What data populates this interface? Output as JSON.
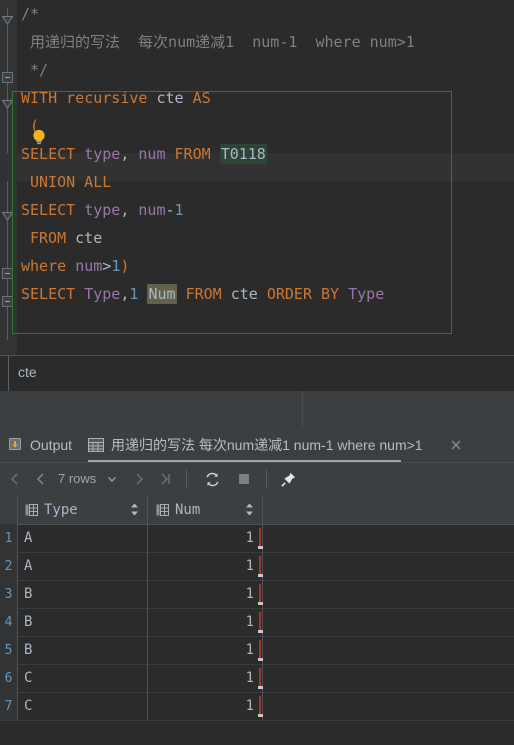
{
  "editor": {
    "lines": [
      {
        "indent": 0,
        "tokens": [
          {
            "t": "/*",
            "c": "cmt"
          }
        ]
      },
      {
        "indent": 1,
        "tokens": [
          {
            "t": "用递归的写法  每次num递减1  num-1  where num>1",
            "c": "cmt"
          }
        ]
      },
      {
        "indent": 1,
        "tokens": [
          {
            "t": "*/",
            "c": "cmt"
          }
        ]
      },
      {
        "indent": 0,
        "tokens": [
          {
            "t": "WITH",
            "c": "kw"
          },
          {
            "t": " ",
            "c": "punc"
          },
          {
            "t": "recursive",
            "c": "kw"
          },
          {
            "t": " ",
            "c": "punc"
          },
          {
            "t": "cte",
            "c": "id"
          },
          {
            "t": " ",
            "c": "punc"
          },
          {
            "t": "AS",
            "c": "kw"
          }
        ]
      },
      {
        "indent": 1,
        "tokens": [
          {
            "t": "(",
            "c": "kw"
          }
        ]
      },
      {
        "indent": 0,
        "tokens": [
          {
            "t": "SELECT",
            "c": "kw"
          },
          {
            "t": " ",
            "c": "punc"
          },
          {
            "t": "type",
            "c": "col"
          },
          {
            "t": ",",
            "c": "punc"
          },
          {
            "t": " ",
            "c": "punc"
          },
          {
            "t": "num",
            "c": "col"
          },
          {
            "t": " ",
            "c": "punc"
          },
          {
            "t": "FROM",
            "c": "kw"
          },
          {
            "t": " ",
            "c": "punc"
          },
          {
            "t": "T0118",
            "c": "id",
            "hl": "green"
          }
        ]
      },
      {
        "indent": 1,
        "tokens": [
          {
            "t": "UNION ALL",
            "c": "kw"
          }
        ]
      },
      {
        "indent": 0,
        "tokens": [
          {
            "t": "SELECT",
            "c": "kw"
          },
          {
            "t": " ",
            "c": "punc"
          },
          {
            "t": "type",
            "c": "col"
          },
          {
            "t": ",",
            "c": "punc"
          },
          {
            "t": " ",
            "c": "punc"
          },
          {
            "t": "num",
            "c": "col"
          },
          {
            "t": "-",
            "c": "punc"
          },
          {
            "t": "1",
            "c": "num"
          }
        ]
      },
      {
        "indent": 1,
        "tokens": [
          {
            "t": "FROM",
            "c": "kw"
          },
          {
            "t": " ",
            "c": "punc"
          },
          {
            "t": "cte",
            "c": "id"
          }
        ]
      },
      {
        "indent": 0,
        "tokens": [
          {
            "t": "where",
            "c": "kw"
          },
          {
            "t": " ",
            "c": "punc"
          },
          {
            "t": "num",
            "c": "col"
          },
          {
            "t": ">",
            "c": "punc"
          },
          {
            "t": "1",
            "c": "num"
          },
          {
            "t": ")",
            "c": "kw"
          }
        ]
      },
      {
        "indent": 0,
        "tokens": [
          {
            "t": "SELECT",
            "c": "kw"
          },
          {
            "t": " ",
            "c": "punc"
          },
          {
            "t": "Type",
            "c": "col"
          },
          {
            "t": ",",
            "c": "punc"
          },
          {
            "t": "1",
            "c": "num"
          },
          {
            "t": " ",
            "c": "punc"
          },
          {
            "t": "Num",
            "c": "id",
            "hl": "olive"
          },
          {
            "t": " ",
            "c": "punc"
          },
          {
            "t": "FROM",
            "c": "kw"
          },
          {
            "t": " ",
            "c": "punc"
          },
          {
            "t": "cte",
            "c": "id"
          },
          {
            "t": " ",
            "c": "punc"
          },
          {
            "t": "ORDER",
            "c": "kw"
          },
          {
            "t": " ",
            "c": "punc"
          },
          {
            "t": "BY",
            "c": "kw"
          },
          {
            "t": " ",
            "c": "punc"
          },
          {
            "t": "Type",
            "c": "col"
          }
        ]
      }
    ],
    "intention_icon": "lightbulb-icon",
    "statement_border_color": "#2d7a2d"
  },
  "cte_strip": {
    "label": "cte"
  },
  "tabs": {
    "output": {
      "label": "Output",
      "icon": "console-output-icon"
    },
    "result": {
      "label": "用递归的写法 每次num递减1  num-1  where num>1",
      "icon": "table-icon",
      "close_icon": "close-icon",
      "active": true
    }
  },
  "result_toolbar": {
    "first_page_icon": "first-page-icon",
    "prev_page_icon": "prev-page-icon",
    "rows_label": "7 rows",
    "rows_dropdown_icon": "chevron-down-icon",
    "next_page_icon": "next-page-icon",
    "last_page_icon": "last-page-icon",
    "refresh_icon": "refresh-icon",
    "stop_icon": "stop-icon",
    "pin_icon": "pin-icon"
  },
  "grid": {
    "columns": [
      {
        "label": "Type",
        "icon": "column-icon",
        "sort_icon": "sort-icon"
      },
      {
        "label": "Num",
        "icon": "column-icon",
        "sort_icon": "sort-icon"
      }
    ],
    "rows": [
      {
        "n": "1",
        "Type": "A",
        "Num": "1"
      },
      {
        "n": "2",
        "Type": "A",
        "Num": "1"
      },
      {
        "n": "3",
        "Type": "B",
        "Num": "1"
      },
      {
        "n": "4",
        "Type": "B",
        "Num": "1"
      },
      {
        "n": "5",
        "Type": "B",
        "Num": "1"
      },
      {
        "n": "6",
        "Type": "C",
        "Num": "1"
      },
      {
        "n": "7",
        "Type": "C",
        "Num": "1"
      }
    ]
  },
  "colors": {
    "editor_bg": "#2b2b2b",
    "panel_bg": "#3c3f41",
    "keyword": "#cc7832",
    "column": "#9876aa",
    "number": "#6897bb",
    "identifier": "#a9b7c6",
    "comment": "#808080",
    "statement_green": "#2d7a2d",
    "bulb_yellow": "#f5b224"
  }
}
